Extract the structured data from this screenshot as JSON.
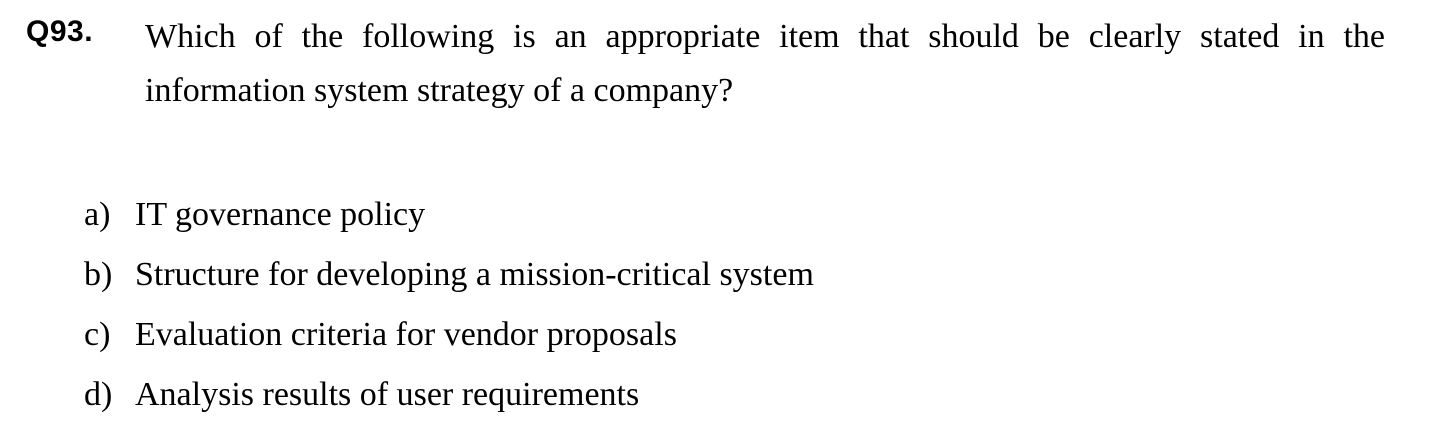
{
  "question": {
    "number": "Q93.",
    "text": "Which of the following is an appropriate item that should be clearly stated in the information system strategy of a company?"
  },
  "options": [
    {
      "letter": "a)",
      "text": "IT governance policy"
    },
    {
      "letter": "b)",
      "text": "Structure for developing a mission-critical system"
    },
    {
      "letter": "c)",
      "text": "Evaluation criteria for vendor proposals"
    },
    {
      "letter": "d)",
      "text": "Analysis results of user requirements"
    }
  ]
}
